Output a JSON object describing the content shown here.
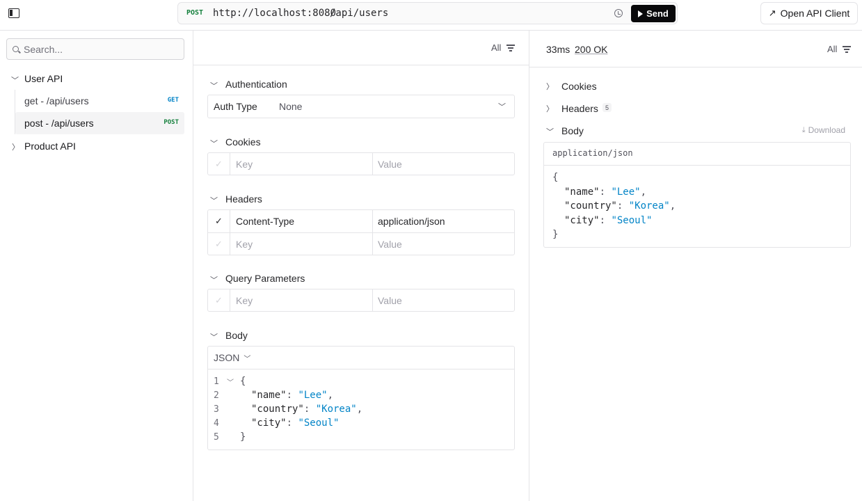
{
  "topbar": {
    "method": "POST",
    "base_url": "http://localhost:8080",
    "path": "/api/users",
    "send_label": "Send",
    "open_client_label": "Open API Client"
  },
  "sidebar": {
    "search_placeholder": "Search...",
    "groups": [
      {
        "label": "User API",
        "expanded": true,
        "items": [
          {
            "label": "get - /api/users",
            "method": "GET"
          },
          {
            "label": "post - /api/users",
            "method": "POST",
            "selected": true
          }
        ]
      },
      {
        "label": "Product API",
        "expanded": false
      }
    ]
  },
  "request": {
    "filter_label": "All",
    "authentication": {
      "title": "Authentication",
      "auth_type_label": "Auth Type",
      "auth_type_value": "None"
    },
    "cookies": {
      "title": "Cookies",
      "key_placeholder": "Key",
      "value_placeholder": "Value"
    },
    "headers": {
      "title": "Headers",
      "rows": [
        {
          "key": "Content-Type",
          "value": "application/json",
          "enabled": true
        }
      ],
      "key_placeholder": "Key",
      "value_placeholder": "Value"
    },
    "query": {
      "title": "Query Parameters",
      "key_placeholder": "Key",
      "value_placeholder": "Value"
    },
    "body": {
      "title": "Body",
      "type": "JSON",
      "line_numbers": [
        "1",
        "2",
        "3",
        "4",
        "5"
      ],
      "fields": [
        {
          "key": "\"name\"",
          "value": "\"Lee\""
        },
        {
          "key": "\"country\"",
          "value": "\"Korea\""
        },
        {
          "key": "\"city\"",
          "value": "\"Seoul\""
        }
      ]
    }
  },
  "response": {
    "timing": "33ms",
    "status": "200 OK",
    "filter_label": "All",
    "cookies_title": "Cookies",
    "headers_title": "Headers",
    "headers_count": "5",
    "body_title": "Body",
    "download_label": "Download",
    "content_type": "application/json",
    "fields": [
      {
        "key": "\"name\"",
        "value": "\"Lee\""
      },
      {
        "key": "\"country\"",
        "value": "\"Korea\""
      },
      {
        "key": "\"city\"",
        "value": "\"Seoul\""
      }
    ]
  },
  "colors": {
    "post": "#15803d",
    "get": "#0284c7",
    "string_value": "#0284c7",
    "send_button": "#09090b",
    "border": "#e4e4e7"
  },
  "icons": {
    "sidebar_toggle": "sidebar-toggle-icon",
    "history": "history-icon",
    "send": "play-icon",
    "open_client": "arrow-up-right-icon",
    "search": "search-icon",
    "filter": "filter-lines-icon",
    "download": "download-icon"
  }
}
